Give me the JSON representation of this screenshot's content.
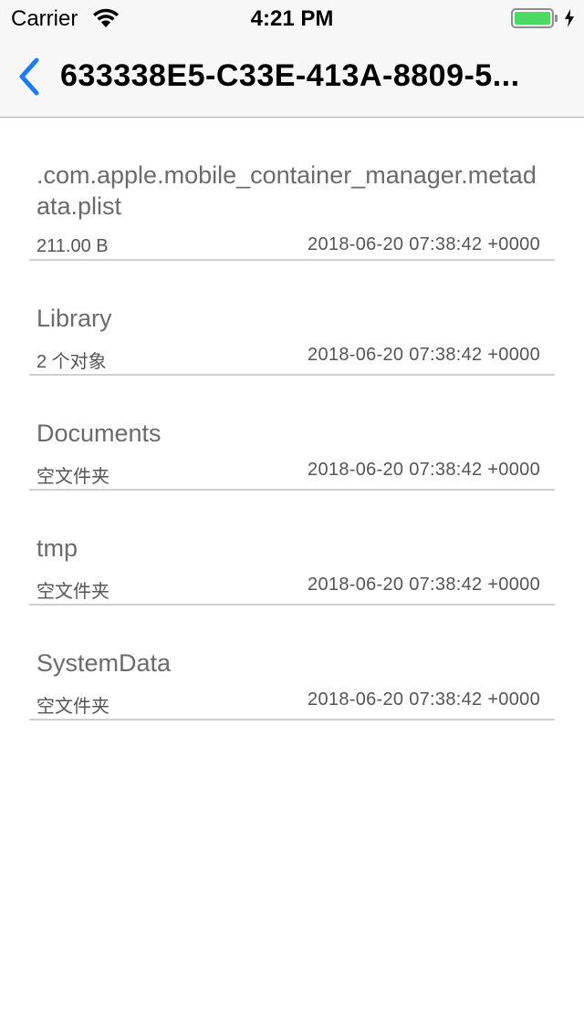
{
  "status_bar": {
    "carrier": "Carrier",
    "time": "4:21 PM",
    "battery_level": 1.0,
    "battery_color": "#4cd964",
    "icons": [
      "wifi-icon",
      "battery-icon",
      "charging-bolt-icon"
    ]
  },
  "nav": {
    "back_icon": "chevron-left-icon",
    "accent_color": "#1e7cf2",
    "title": "633338E5-C33E-413A-8809-5..."
  },
  "files": [
    {
      "name": ".com.apple.mobile_container_manager.metadata.plist",
      "detail": "211.00 B",
      "date": "2018-06-20 07:38:42 +0000"
    },
    {
      "name": "Library",
      "detail": "2 个对象",
      "date": "2018-06-20 07:38:42 +0000"
    },
    {
      "name": "Documents",
      "detail": "空文件夹",
      "date": "2018-06-20 07:38:42 +0000"
    },
    {
      "name": "tmp",
      "detail": "空文件夹",
      "date": "2018-06-20 07:38:42 +0000"
    },
    {
      "name": "SystemData",
      "detail": "空文件夹",
      "date": "2018-06-20 07:38:42 +0000"
    }
  ]
}
